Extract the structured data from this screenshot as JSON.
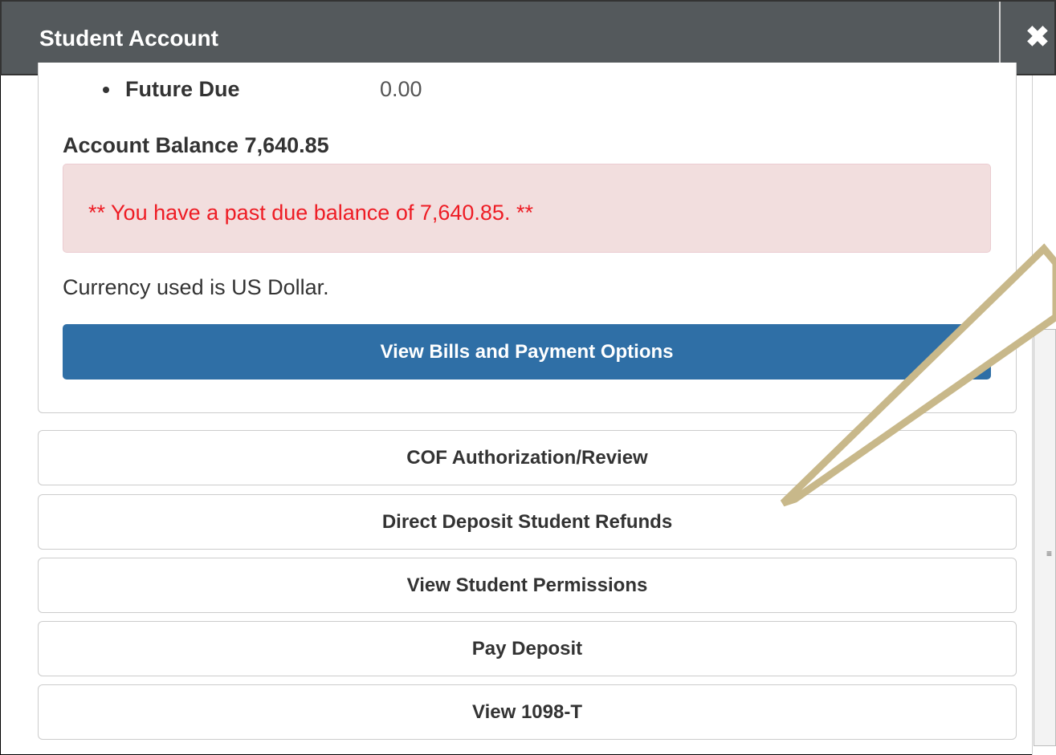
{
  "window": {
    "title": "Student Account",
    "close_icon": "close-icon"
  },
  "summary": {
    "future_due_label": "Future Due",
    "future_due_value": "0.00",
    "account_balance": "Account Balance 7,640.85",
    "alert_text": "** You have a past due balance of 7,640.85. **",
    "currency_note": "Currency used is US Dollar.",
    "view_bills_label": "View Bills and Payment Options"
  },
  "actions": [
    {
      "label": "COF Authorization/Review"
    },
    {
      "label": "Direct Deposit Student Refunds"
    },
    {
      "label": "View Student Permissions"
    },
    {
      "label": "Pay Deposit"
    },
    {
      "label": "View 1098-T"
    }
  ],
  "scrollbar": {
    "grip_glyph": "≡"
  },
  "colors": {
    "titlebar": "#54595c",
    "primary_button": "#2f6fa6",
    "alert_background": "#f2dede",
    "alert_text": "#ee1c24",
    "annotation_arrow": "#c8b88a"
  }
}
